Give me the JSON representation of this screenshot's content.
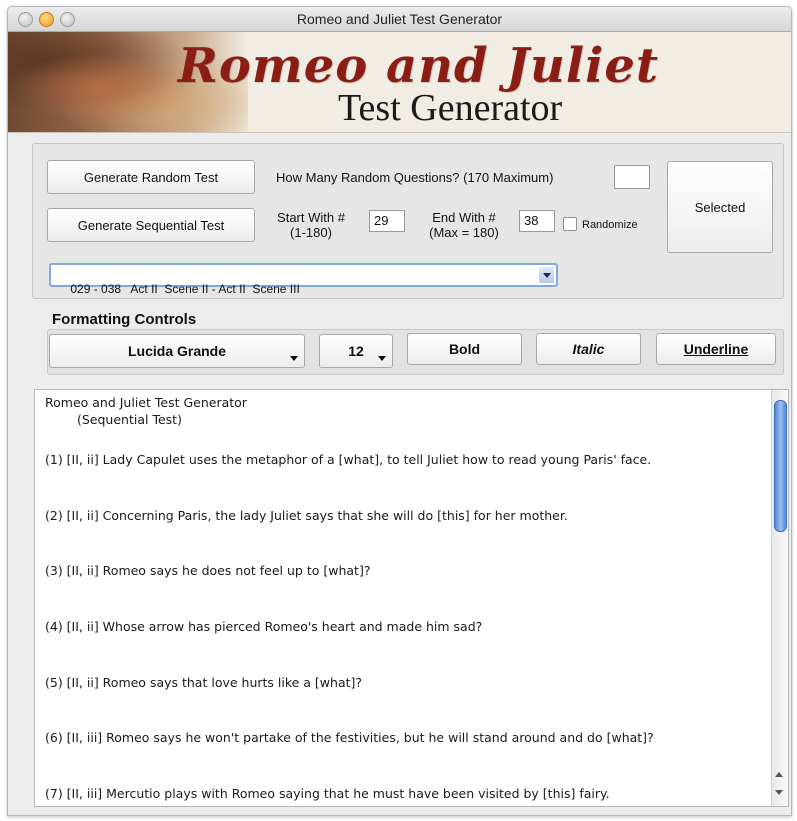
{
  "window": {
    "title": "Romeo and Juliet Test Generator"
  },
  "banner": {
    "title": "Romeo and Juliet",
    "subtitle": "Test Generator"
  },
  "controls": {
    "random_button": "Generate Random Test",
    "sequential_button": "Generate Sequential Test",
    "how_many_label": "How Many Random Questions? (170 Maximum)",
    "how_many_value": "",
    "selected_button": "Selected",
    "start_label_line1": "Start With #",
    "start_label_line2": "(1-180)",
    "start_value": "29",
    "end_label_line1": "End With #",
    "end_label_line2": "(Max = 180)",
    "end_value": "38",
    "randomize_label": "Randomize",
    "randomize_checked": false,
    "range_selection": "029 - 038   Act II  Scene II - Act II  Scene III"
  },
  "formatting": {
    "section_label": "Formatting Controls",
    "font": "Lucida Grande",
    "size": "12",
    "bold": "Bold",
    "italic": "Italic",
    "underline": "Underline"
  },
  "document": {
    "title": "Romeo and Juliet Test Generator",
    "subtitle": "(Sequential Test)",
    "questions": [
      "(1)  [II, ii] Lady Capulet uses the metaphor of a [what], to tell Juliet how to read young Paris' face.",
      "(2)  [II, ii] Concerning Paris, the lady Juliet says that she will do [this] for her mother.",
      "(3)  [II, ii] Romeo says he does not feel up to [what]?",
      "(4)  [II, ii] Whose arrow has pierced Romeo's heart and made him sad?",
      "(5)  [II, ii] Romeo says that love hurts like a [what]?",
      "(6)  [II, iii] Romeo says he won't partake of the festivities, but he will stand around and do [what]?",
      "(7)  [II, iii] Mercutio plays with Romeo saying that he must have been visited by [this] fairy."
    ]
  },
  "colors": {
    "banner_title": "#8b1e14",
    "focus_ring": "#7fa7e3",
    "scroll_thumb": "#4f86d8"
  },
  "icons": [
    "close-icon",
    "minimize-icon",
    "zoom-icon",
    "chevron-down-icon",
    "scroll-up-icon",
    "scroll-down-icon"
  ]
}
